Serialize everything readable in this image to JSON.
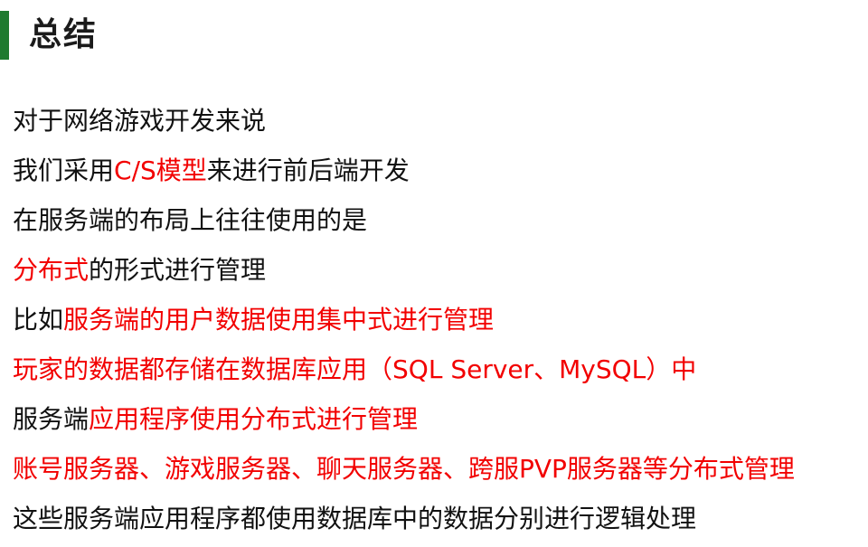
{
  "title": "总结",
  "lines": [
    [
      {
        "text": "对于网络游戏开发来说",
        "color": "black"
      }
    ],
    [
      {
        "text": "我们采用",
        "color": "black"
      },
      {
        "text": "C/S模型",
        "color": "red"
      },
      {
        "text": "来进行前后端开发",
        "color": "black"
      }
    ],
    [
      {
        "text": "在服务端的布局上往往使用的是",
        "color": "black"
      }
    ],
    [
      {
        "text": "分布式",
        "color": "red"
      },
      {
        "text": "的形式进行管理",
        "color": "black"
      }
    ],
    [
      {
        "text": "比如",
        "color": "black"
      },
      {
        "text": "服务端的用户数据使用集中式进行管理",
        "color": "red"
      }
    ],
    [
      {
        "text": "玩家的数据都存储在数据库应用（SQL Server、MySQL）中",
        "color": "red"
      }
    ],
    [
      {
        "text": "服务端",
        "color": "black"
      },
      {
        "text": "应用程序使用分布式进行管理",
        "color": "red"
      }
    ],
    [
      {
        "text": "账号服务器、游戏服务器、聊天服务器、跨服PVP服务器等分布式管理",
        "color": "red"
      }
    ],
    [
      {
        "text": "这些服务端应用程序都使用数据库中的数据分别进行逻辑处理",
        "color": "black"
      }
    ]
  ],
  "colors": {
    "accent_bar": "#1e7a2f",
    "highlight": "#f20000",
    "text": "#111111"
  }
}
